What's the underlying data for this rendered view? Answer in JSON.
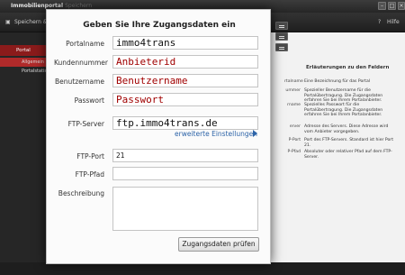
{
  "window": {
    "title": "Immobilienportal",
    "subtitle": "Speichern",
    "help_label": "Hilfe",
    "save_label": "Speichern & Sch",
    "colors": {
      "accent": "#9b1e1e",
      "link": "#2d64a8",
      "value_red": "#a00000"
    }
  },
  "sidebar": {
    "header": "Portal",
    "items": [
      {
        "label": "Allgemein"
      },
      {
        "label": "Portalstatis"
      }
    ]
  },
  "right_panel": {
    "title": "Erläuterungen zu den Feldern",
    "rows": [
      {
        "key": "rtalname",
        "text": "Eine Bezeichnung für das Portal"
      },
      {
        "key": "ummer",
        "text": "Spezieller Benutzername für die Portalübertragung. Die Zugangsdaten erfahren Sie bei Ihrem Portalanbieter."
      },
      {
        "key": "rname",
        "text": "Spezielles Passwort für die Portalübertragung. Die Zugangsdaten erfahren Sie bei Ihrem Portalanbieter."
      },
      {
        "key": "erver",
        "text": "Adresse des Servers. Diese Adresse wird vom Anbieter vorgegeben."
      },
      {
        "key": "P-Port",
        "text": "Port des FTP-Servers. Standard ist hier Port 21."
      },
      {
        "key": "P-Pfad",
        "text": "Absoluter oder relativer Pfad auf dem FTP-Server."
      }
    ]
  },
  "dialog": {
    "title": "Geben Sie Ihre Zugangsdaten ein",
    "fields": {
      "portalname": {
        "label": "Portalname",
        "value": "immo4trans"
      },
      "kundennummer": {
        "label": "Kundennummer",
        "value": "Anbieterid"
      },
      "benutzername": {
        "label": "Benutzername",
        "value": "Benutzername"
      },
      "passwort": {
        "label": "Passwort",
        "value": "Passwort"
      },
      "ftp_server": {
        "label": "FTP-Server",
        "value": "ftp.immo4trans.de"
      },
      "ftp_port": {
        "label": "FTP-Port",
        "value": "21"
      },
      "ftp_pfad": {
        "label": "FTP-Pfad",
        "value": ""
      },
      "beschreibung": {
        "label": "Beschreibung",
        "value": ""
      }
    },
    "advanced_link": "erweiterte Einstellungen",
    "check_button": "Zugangsdaten prüfen"
  }
}
